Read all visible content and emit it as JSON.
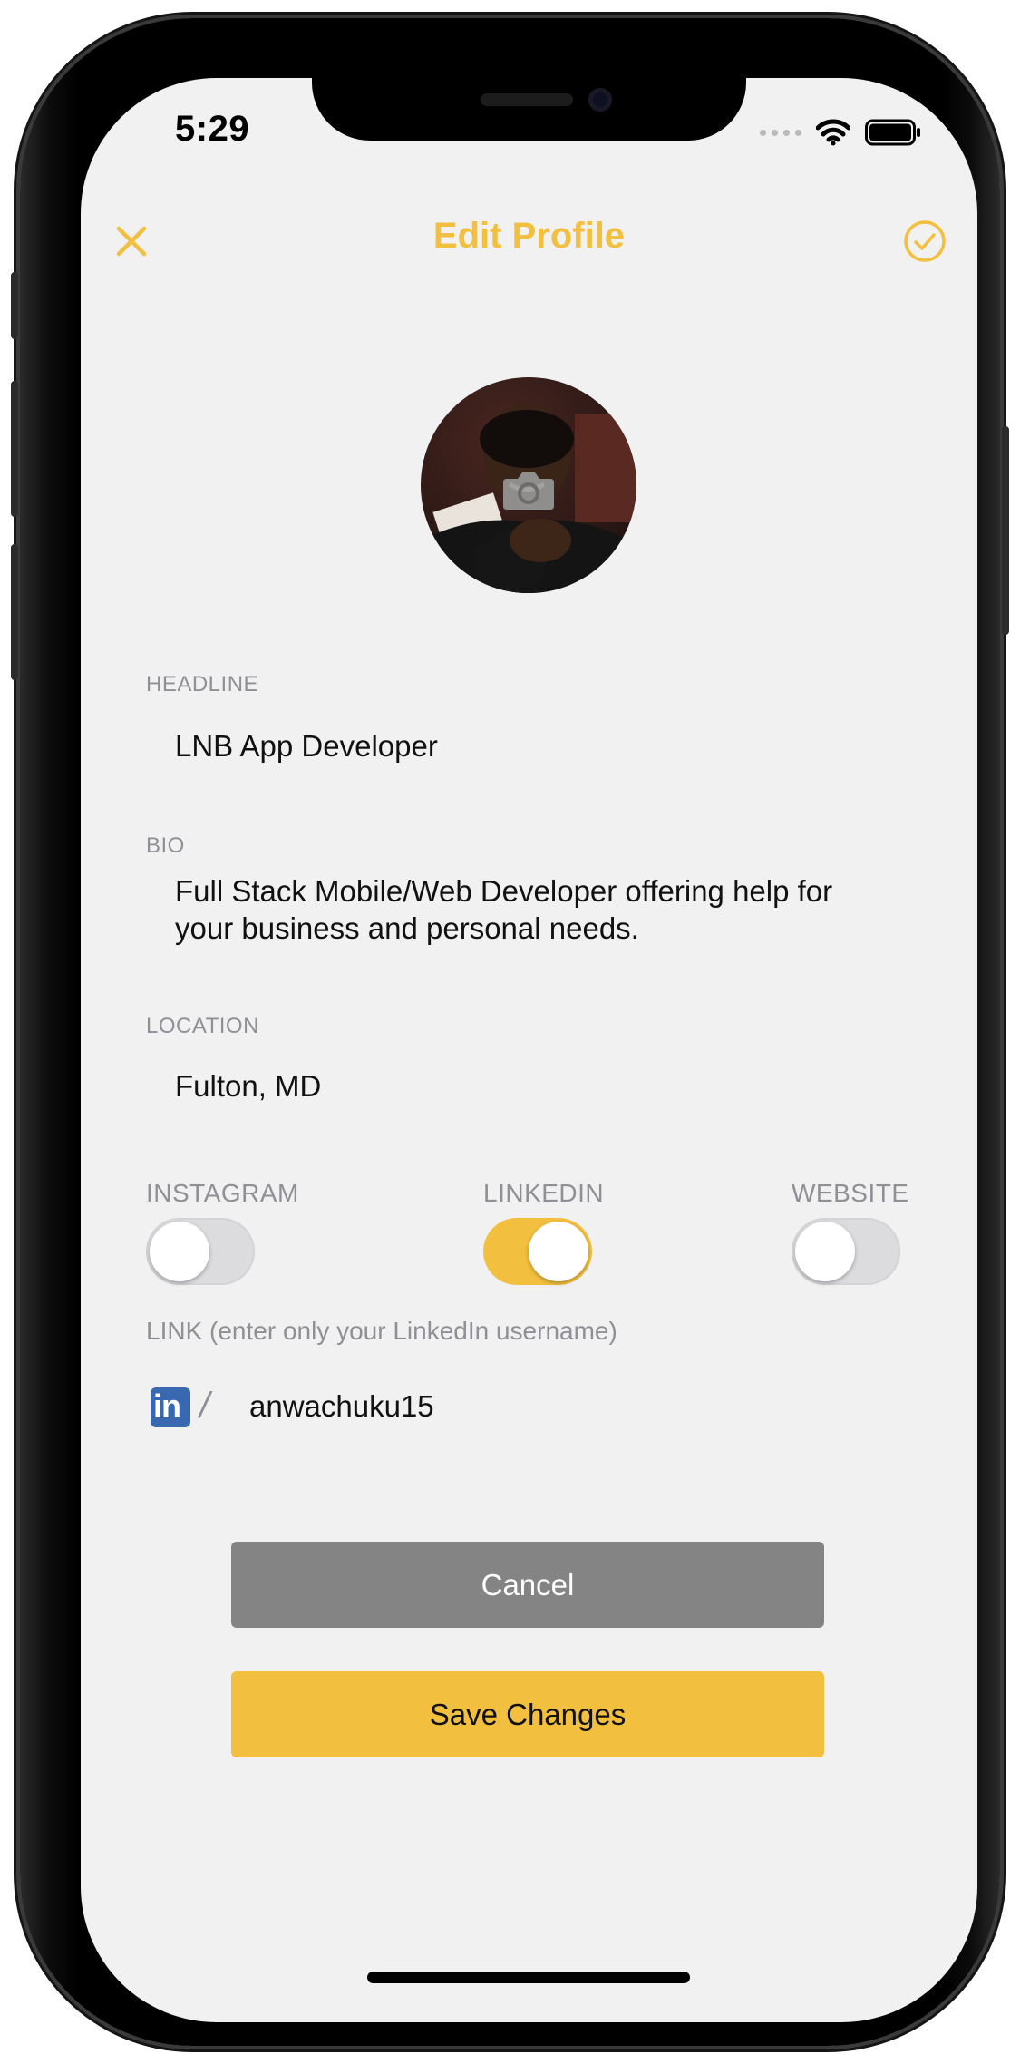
{
  "status_bar": {
    "time": "5:29"
  },
  "header": {
    "title": "Edit Profile"
  },
  "colors": {
    "accent": "#f2bf3f",
    "cancel": "#848484",
    "linkedin": "#3968b0"
  },
  "avatar": {
    "camera_icon": "camera-icon"
  },
  "fields": {
    "headline": {
      "label": "HEADLINE",
      "value": "LNB App Developer"
    },
    "bio": {
      "label": "BIO",
      "line1": "Full Stack Mobile/Web Developer offering help for",
      "line2": "your business and personal needs."
    },
    "location": {
      "label": "LOCATION",
      "value": "Fulton, MD"
    }
  },
  "toggles": [
    {
      "label": "INSTAGRAM",
      "on": false
    },
    {
      "label": "LINKEDIN",
      "on": true
    },
    {
      "label": "WEBSITE",
      "on": false
    }
  ],
  "link": {
    "label": "LINK (enter only your LinkedIn username)",
    "icon_text": "in",
    "separator": "/",
    "value": "anwachuku15"
  },
  "buttons": {
    "cancel": "Cancel",
    "save": "Save Changes"
  }
}
